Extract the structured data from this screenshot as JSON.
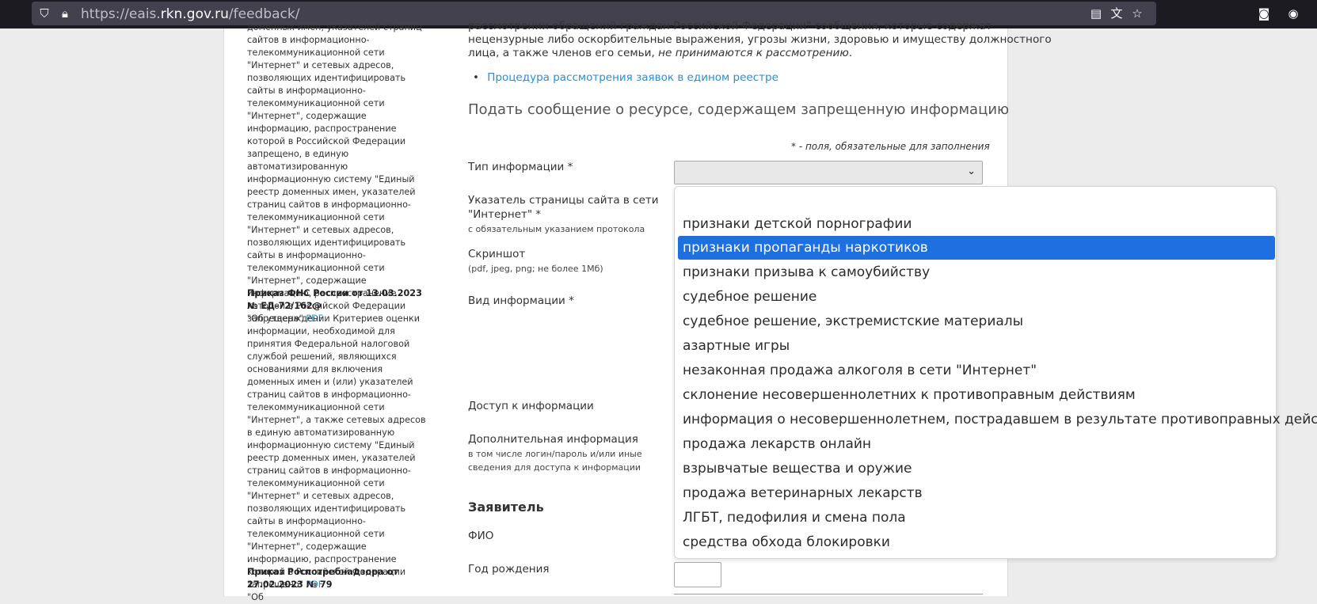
{
  "browser": {
    "url_prefix": "https://eais.",
    "url_domain": "rkn.gov.ru",
    "url_path": "/feedback/"
  },
  "sidebar": {
    "block1_text": "доменных имен, указателей страниц сайтов в информационно-телекоммуникационной сети \"Интернет\" и сетевых адресов, позволяющих идентифицировать сайты в информационно-телекоммуникационной сети \"Интернет\", содержащие информацию, распространение которой в Российской Федерации запрещено, в единую автоматизированную информационную систему \"Единый реестр доменных имен, указателей страниц сайтов в информационно-телекоммуникационной сети \"Интернет\" и сетевых адресов, позволяющих идентифицировать сайты в информационно-телекоммуникационной сети \"Интернет\", содержащие информацию, распространение которой в Российской Федерации запрещено\"",
    "pdf_label": "PDF",
    "block2_title": "Приказ ФНС России от 13.03.2023 № ЕД-72/162@",
    "block2_text": "\"Об утверждении Критериев оценки информации, необходимой для принятия Федеральной налоговой службой решений, являющихся основаниями для включения доменных имен и (или) указателей страниц сайтов в информационно-телекоммуникационной сети \"Интернет\", а также сетевых адресов в единую автоматизированную информационную систему \"Единый реестр доменных имен, указателей страниц сайтов в информационно-телекоммуникационной сети \"Интернет\" и сетевых адресов, позволяющих идентифицировать сайты в информационно-телекоммуникационной сети \"Интернет\", содержащие информацию, распространение которой в Российской Федерации запрещено\"",
    "block3_title": "Приказ Роспотребнадзора от 27.02.2023 № 79",
    "block3_text": "\"Об"
  },
  "main": {
    "intro_line1": "рассмотрении обращений граждан Российской Федерации\" сообщения, которые содержат",
    "intro_line2": "нецензурные либо оскорбительные выражения, угрозы жизни, здоровью и имуществу должностного",
    "intro_line3a": "лица, а также членов его семьи,",
    "intro_line3b": "не принимаются к рассмотрению",
    "procedure_link": "Процедура рассмотрения заявок в едином реестре",
    "form_title": "Подать сообщение о ресурсе, содержащем запрещенную информацию",
    "required_note": "* - поля, обязательные для заполнения",
    "info_type_label": "Тип информации *",
    "url_label": "Указатель страницы сайта в сети \"Интернет\" *",
    "url_sub": "с обязательным указанием протокола",
    "screenshot_label": "Скриншот",
    "screenshot_sub": "(pdf, jpeg, png; не более 1Мб)",
    "info_kind_label": "Вид информации *",
    "access_label": "Доступ к информации",
    "extra_label": "Дополнительная информация",
    "extra_sub": "в том числе логин/пароль и/или иные сведения для доступа к информации",
    "applicant_heading": "Заявитель",
    "fio_label": "ФИО",
    "birth_label": "Год рождения"
  },
  "dropdown": {
    "options": [
      "",
      "признаки детской порнографии",
      "признаки пропаганды наркотиков",
      "признаки призыва к самоубийству",
      "судебное решение",
      "судебное решение, экстремистские материалы",
      "азартные игры",
      "незаконная продажа алкоголя в сети \"Интернет\"",
      "склонение несовершеннолетних к противоправным действиям",
      "информация о несовершеннолетнем, пострадавшем в результате противоправных действий",
      "продажа лекарств онлайн",
      "взрывчатые вещества и оружие",
      "продажа ветеринарных лекарств",
      "ЛГБТ, педофилия и смена пола",
      "средства обхода блокировки"
    ],
    "selected_index": 2
  },
  "colors": {
    "highlight": "#1e6fe0",
    "link": "#2a8fd0"
  }
}
